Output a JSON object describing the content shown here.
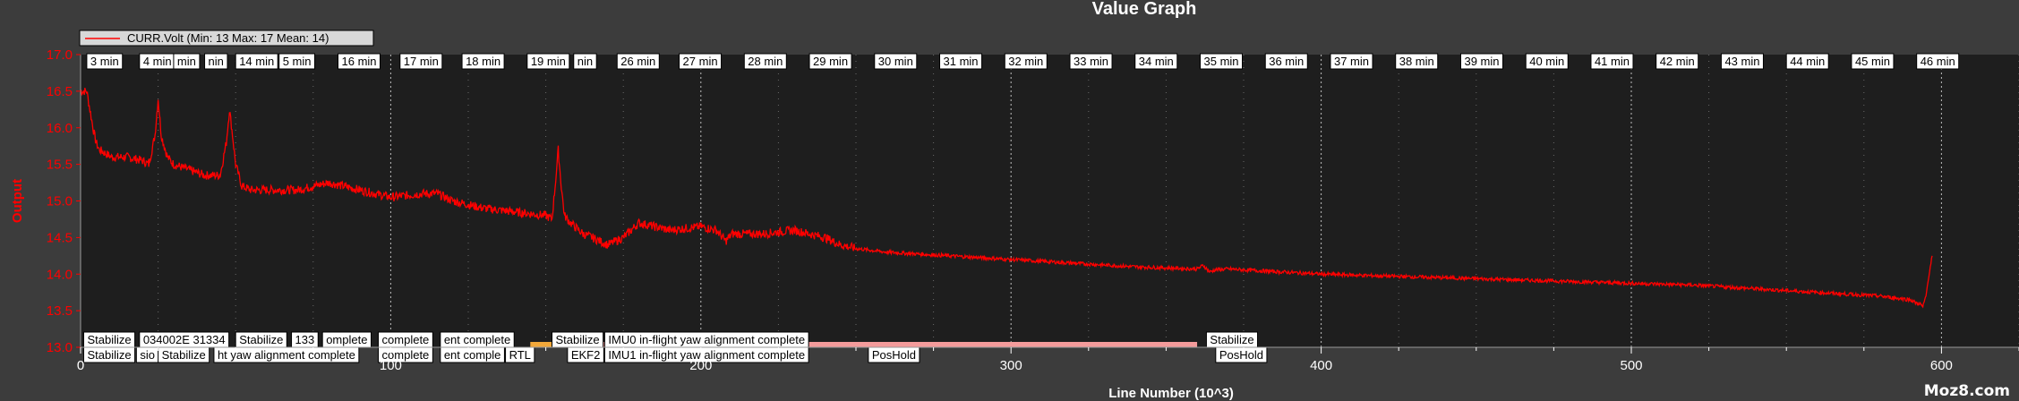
{
  "window": {
    "title": "Value Graph",
    "watermark": "Moz8.com"
  },
  "colors": {
    "background": "#3c3c3c",
    "plot_background": "#1e1e1e",
    "series": "#ff0000",
    "y_axis_text": "#ff0000",
    "x_axis_text": "#ffffff",
    "label_box": "#ffffff"
  },
  "chart_data": {
    "type": "line",
    "title": "Value Graph",
    "xlabel": "Line Number (10^3)",
    "ylabel": "Output",
    "xlim": [
      0,
      625
    ],
    "ylim": [
      13.0,
      17.0
    ],
    "x_ticks": [
      0,
      100,
      200,
      300,
      400,
      500,
      600
    ],
    "y_ticks": [
      13.0,
      13.5,
      14.0,
      14.5,
      15.0,
      15.5,
      16.0,
      16.5,
      17.0
    ],
    "grid": "dotted-vertical",
    "legend": {
      "position": "top-left",
      "entries": [
        "CURR.Volt (Min: 13 Max: 17 Mean: 14)"
      ]
    },
    "series": [
      {
        "name": "CURR.Volt (Min: 13 Max: 17 Mean: 14)",
        "color": "#ff0000",
        "x": [
          0,
          2,
          4,
          5,
          6,
          8,
          10,
          15,
          20,
          22,
          24,
          25,
          26,
          28,
          30,
          40,
          45,
          47,
          48,
          49,
          50,
          52,
          55,
          60,
          70,
          80,
          90,
          100,
          110,
          115,
          120,
          130,
          140,
          150,
          152,
          153,
          154,
          155,
          156,
          158,
          162,
          165,
          170,
          175,
          178,
          180,
          185,
          190,
          200,
          205,
          208,
          210,
          220,
          230,
          240,
          245,
          250,
          260,
          280,
          300,
          320,
          340,
          360,
          362,
          364,
          366,
          370,
          400,
          440,
          480,
          520,
          560,
          580,
          590,
          592,
          593,
          594,
          595,
          596,
          597
        ],
        "y": [
          16.5,
          16.5,
          16.0,
          15.8,
          15.7,
          15.65,
          15.6,
          15.6,
          15.55,
          15.5,
          15.9,
          16.4,
          15.9,
          15.6,
          15.5,
          15.35,
          15.35,
          15.8,
          16.25,
          15.9,
          15.5,
          15.2,
          15.15,
          15.15,
          15.15,
          15.25,
          15.15,
          15.05,
          15.1,
          15.1,
          15.0,
          14.9,
          14.85,
          14.8,
          14.75,
          15.2,
          15.7,
          15.2,
          14.8,
          14.7,
          14.55,
          14.5,
          14.4,
          14.5,
          14.62,
          14.7,
          14.65,
          14.6,
          14.65,
          14.6,
          14.45,
          14.55,
          14.55,
          14.6,
          14.5,
          14.4,
          14.35,
          14.3,
          14.25,
          14.2,
          14.15,
          14.1,
          14.07,
          14.12,
          14.03,
          14.06,
          14.07,
          14.0,
          13.95,
          13.9,
          13.85,
          13.75,
          13.7,
          13.65,
          13.6,
          13.6,
          13.55,
          13.7,
          14.0,
          14.25
        ]
      }
    ],
    "time_labels": [
      {
        "text": "3 min",
        "x": 2
      },
      {
        "text": "4 min",
        "x": 19
      },
      {
        "text": "min",
        "x": 30
      },
      {
        "text": "nin",
        "x": 40
      },
      {
        "text": "14 min",
        "x": 50
      },
      {
        "text": "5 min",
        "x": 64
      },
      {
        "text": "16 min",
        "x": 83
      },
      {
        "text": "17 min",
        "x": 103
      },
      {
        "text": "18 min",
        "x": 123
      },
      {
        "text": "19 min",
        "x": 144
      },
      {
        "text": "nin",
        "x": 159
      },
      {
        "text": "26 min",
        "x": 173
      },
      {
        "text": "27 min",
        "x": 193
      },
      {
        "text": "28 min",
        "x": 214
      },
      {
        "text": "29 min",
        "x": 235
      },
      {
        "text": "30 min",
        "x": 256
      },
      {
        "text": "31 min",
        "x": 277
      },
      {
        "text": "32 min",
        "x": 298
      },
      {
        "text": "33 min",
        "x": 319
      },
      {
        "text": "34 min",
        "x": 340
      },
      {
        "text": "35 min",
        "x": 361
      },
      {
        "text": "36 min",
        "x": 382
      },
      {
        "text": "37 min",
        "x": 403
      },
      {
        "text": "38 min",
        "x": 424
      },
      {
        "text": "39 min",
        "x": 445
      },
      {
        "text": "40 min",
        "x": 466
      },
      {
        "text": "41 min",
        "x": 487
      },
      {
        "text": "42 min",
        "x": 508
      },
      {
        "text": "43 min",
        "x": 529
      },
      {
        "text": "44 min",
        "x": 550
      },
      {
        "text": "45 min",
        "x": 571
      },
      {
        "text": "46 min",
        "x": 592
      }
    ],
    "event_labels_row1": [
      {
        "text": "Stabilize",
        "x": 1
      },
      {
        "text": "034002E 31334",
        "x": 19
      },
      {
        "text": "Stabilize",
        "x": 50
      },
      {
        "text": "133",
        "x": 68
      },
      {
        "text": "omplete",
        "x": 78
      },
      {
        "text": "complete",
        "x": 96
      },
      {
        "text": "ent complete",
        "x": 116
      },
      {
        "text": "Stabilize",
        "x": 152
      },
      {
        "text": "IMU0 in-flight yaw alignment complete",
        "x": 169
      },
      {
        "text": "Stabilize",
        "x": 363
      }
    ],
    "event_labels_row2": [
      {
        "text": "Stabilize",
        "x": 1
      },
      {
        "text": "sio",
        "x": 18
      },
      {
        "text": "Stabilize",
        "x": 25
      },
      {
        "text": "ht yaw alignment complete",
        "x": 43
      },
      {
        "text": "complete",
        "x": 96
      },
      {
        "text": "ent comple",
        "x": 116
      },
      {
        "text": "RTL",
        "x": 137
      },
      {
        "text": "EKF2",
        "x": 157
      },
      {
        "text": "IMU1 in-flight yaw alignment complete",
        "x": 169
      },
      {
        "text": "PosHold",
        "x": 254
      },
      {
        "text": "PosHold",
        "x": 366
      }
    ]
  }
}
